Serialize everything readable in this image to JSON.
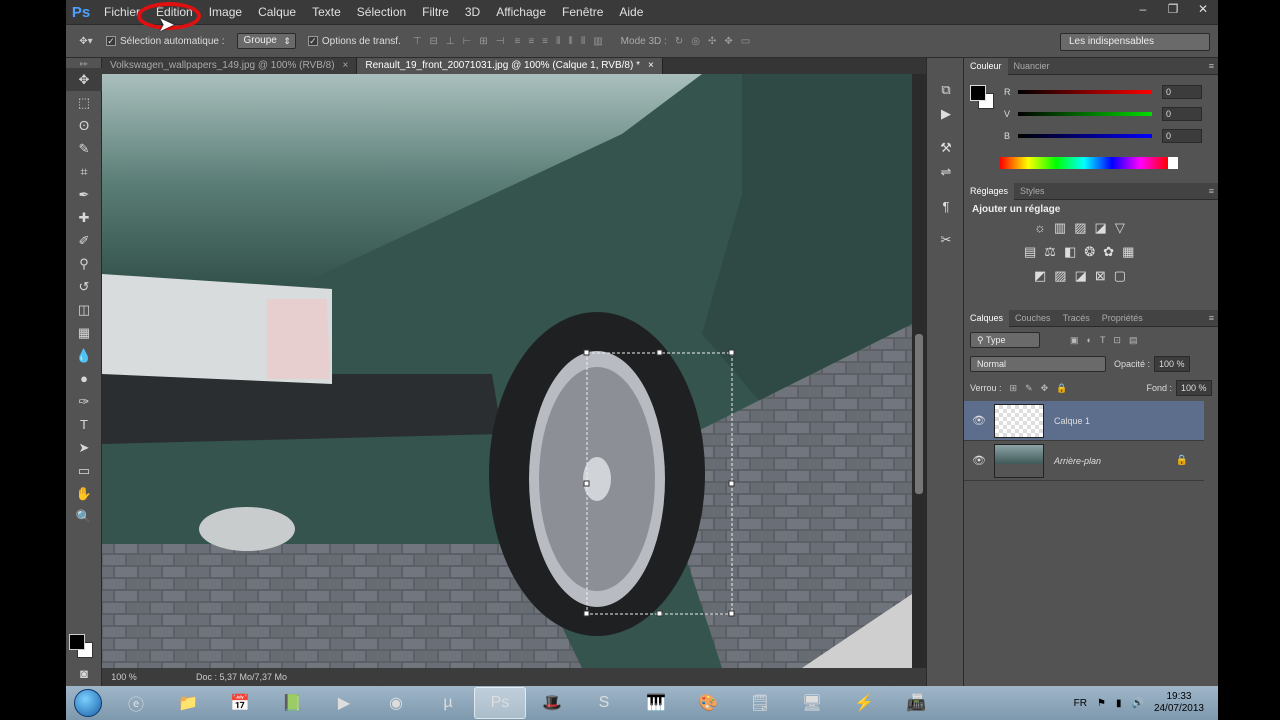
{
  "app": {
    "logo": "Ps"
  },
  "menu": [
    "Fichier",
    "Édition",
    "Image",
    "Calque",
    "Texte",
    "Sélection",
    "Filtre",
    "3D",
    "Affichage",
    "Fenêtre",
    "Aide"
  ],
  "window_controls": [
    "–",
    "❐",
    "✕"
  ],
  "options_bar": {
    "auto_select_label": "Sélection automatique :",
    "auto_select_value": "Groupe",
    "transform_label": "Options de transf.",
    "mode3d_label": "Mode 3D :",
    "workspace": "Les indispensables"
  },
  "doc_tabs": [
    {
      "label": "Volkswagen_wallpapers_149.jpg @ 100% (RVB/8)",
      "close": "×"
    },
    {
      "label": "Renault_19_front_20071031.jpg @ 100% (Calque 1, RVB/8) *",
      "close": "×"
    }
  ],
  "status": {
    "zoom": "100 %",
    "doc": "Doc : 5,37 Mo/7,37 Mo"
  },
  "color_panel": {
    "tabs": [
      "Couleur",
      "Nuancier"
    ],
    "channels": [
      {
        "label": "R",
        "value": "0",
        "color": "#ff0000"
      },
      {
        "label": "V",
        "value": "0",
        "color": "#00d000"
      },
      {
        "label": "B",
        "value": "0",
        "color": "#0000ff"
      }
    ]
  },
  "adjust_panel": {
    "tabs": [
      "Réglages",
      "Styles"
    ],
    "title": "Ajouter un réglage"
  },
  "layers_panel": {
    "tabs": [
      "Calques",
      "Couches",
      "Tracés",
      "Propriétés"
    ],
    "filter_type": "Type",
    "blend_mode": "Normal",
    "opacity_label": "Opacité :",
    "opacity_value": "100 %",
    "lock_label": "Verrou :",
    "fill_label": "Fond :",
    "fill_value": "100 %",
    "layers": [
      {
        "name": "Calque 1",
        "selected": true
      },
      {
        "name": "Arrière-plan",
        "selected": false
      }
    ]
  },
  "taskbar": {
    "lang": "FR",
    "time": "19:33",
    "date": "24/07/2013"
  }
}
